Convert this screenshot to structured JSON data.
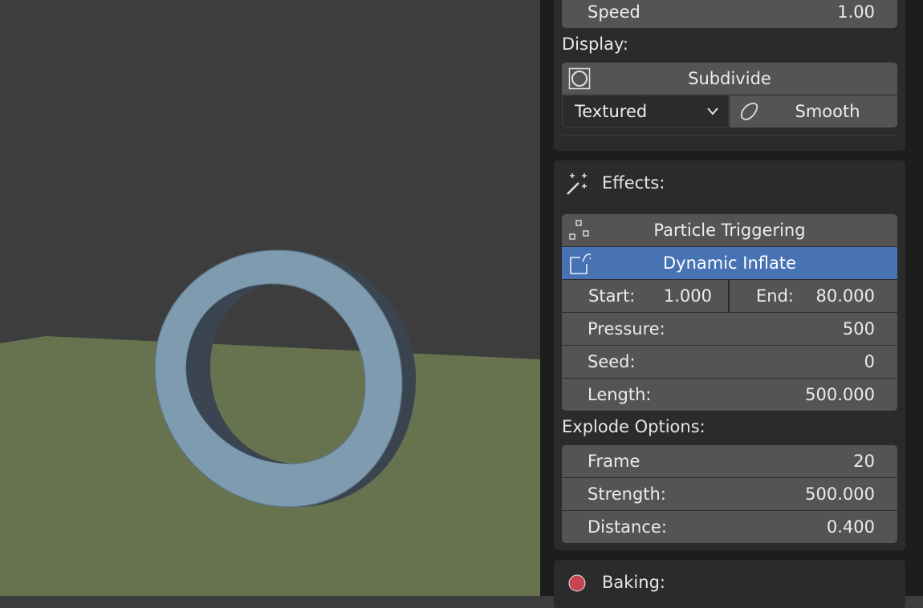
{
  "colors": {
    "background": "#3d3d3d",
    "ground": "#67734f",
    "ring_face": "#7f9bb0",
    "ring_inner": "#3b4652",
    "panel_bg": "#1d1d1d",
    "field_bg": "#545454",
    "active_accent": "#4772b3",
    "baking_dot": "#c64552"
  },
  "physics": {
    "speed": {
      "label": "Speed",
      "value": "1.00"
    },
    "display_label": "Display:",
    "subdivide_label": "Subdivide",
    "display_mode": "Textured",
    "smooth_label": "Smooth"
  },
  "effects": {
    "header": "Effects:",
    "header_icon": "magic-wand-icon",
    "particle_triggering": {
      "label": "Particle Triggering",
      "icon": "particles-icon"
    },
    "dynamic_inflate": {
      "label": "Dynamic Inflate",
      "icon": "modifier-icon"
    },
    "start": {
      "label": "Start:",
      "value": "1.000"
    },
    "end": {
      "label": "End:",
      "value": "80.000"
    },
    "pressure": {
      "label": "Pressure:",
      "value": "500"
    },
    "seed": {
      "label": "Seed:",
      "value": "0"
    },
    "length": {
      "label": "Length:",
      "value": "500.000"
    }
  },
  "explode": {
    "header": "Explode Options:",
    "frame": {
      "label": "Frame",
      "value": "20"
    },
    "strength": {
      "label": "Strength:",
      "value": "500.000"
    },
    "distance": {
      "label": "Distance:",
      "value": "0.400"
    }
  },
  "baking": {
    "header": "Baking:",
    "icon": "record-dot-icon"
  }
}
